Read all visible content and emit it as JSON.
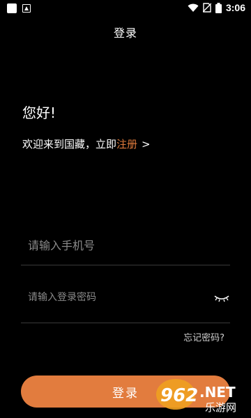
{
  "status_bar": {
    "time": "3:06"
  },
  "header": {
    "title": "登录"
  },
  "greeting": "您好!",
  "welcome": {
    "prefix": "欢迎来到国藏，立即",
    "register_link": "注册",
    "chevron": ">"
  },
  "phone_field": {
    "placeholder": "请输入手机号",
    "value": ""
  },
  "password_field": {
    "placeholder": "请输入登录密码",
    "value": ""
  },
  "forgot_password": "忘记密码?",
  "login_button": "登录",
  "watermark": {
    "number": "962",
    "suffix": ".NET",
    "site_name": "乐游网"
  },
  "colors": {
    "accent": "#e27c3e",
    "background": "#000000"
  },
  "icons": [
    "app-square-icon",
    "app-notification-icon",
    "wifi-icon",
    "no-sim-icon",
    "battery-icon",
    "eye-closed-icon"
  ]
}
